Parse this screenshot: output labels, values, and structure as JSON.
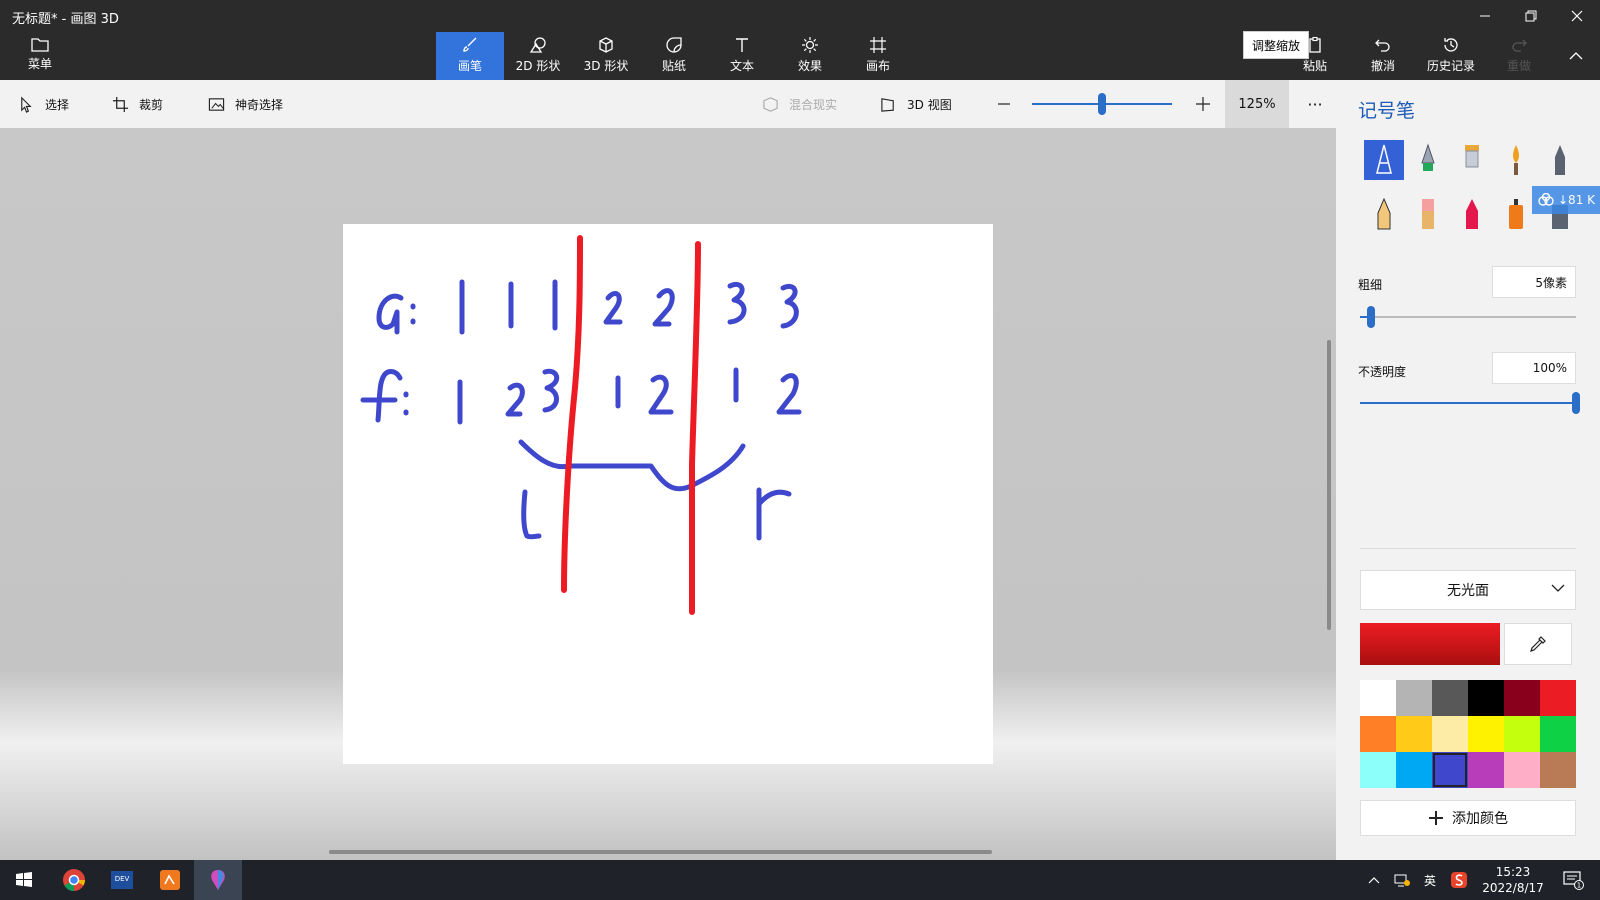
{
  "window": {
    "title": "无标题* - 画图 3D"
  },
  "ribbon": {
    "menu_label": "菜单",
    "tools": [
      "画笔",
      "2D 形状",
      "3D 形状",
      "贴纸",
      "文本",
      "效果",
      "画布"
    ],
    "actions": [
      "粘贴",
      "撤消",
      "历史记录",
      "重做"
    ]
  },
  "tooltip": {
    "text": "调整缩放"
  },
  "subbar": {
    "select": "选择",
    "crop": "裁剪",
    "magic_select": "神奇选择",
    "mixed_reality": "混合现实",
    "view_3d": "3D 视图",
    "zoom": "125%",
    "zoom_slider_fraction": 0.5,
    "more": "···"
  },
  "panel": {
    "title": "记号笔",
    "cloud_badge": "↓81 K",
    "thickness_label": "粗细",
    "thickness_value": "5像素",
    "thickness_fraction": 0.05,
    "opacity_label": "不透明度",
    "opacity_value": "100%",
    "opacity_fraction": 1.0,
    "finish": "无光面",
    "current_color": "#ed1c24",
    "palette": [
      "#ffffff",
      "#b4b4b4",
      "#585858",
      "#000000",
      "#88001b",
      "#ec1c24",
      "#ff7f27",
      "#ffca18",
      "#fdeca6",
      "#fff200",
      "#c4ff0e",
      "#0ed145",
      "#8cfffb",
      "#00a8f3",
      "#3f48cc",
      "#b83dba",
      "#ffaec8",
      "#b97a56"
    ],
    "palette_selected": "#3f48cc",
    "add_color": "添加颜色"
  },
  "taskbar": {
    "ime": "英",
    "time": "15:23",
    "date": "2022/8/17",
    "notifications": "1"
  }
}
